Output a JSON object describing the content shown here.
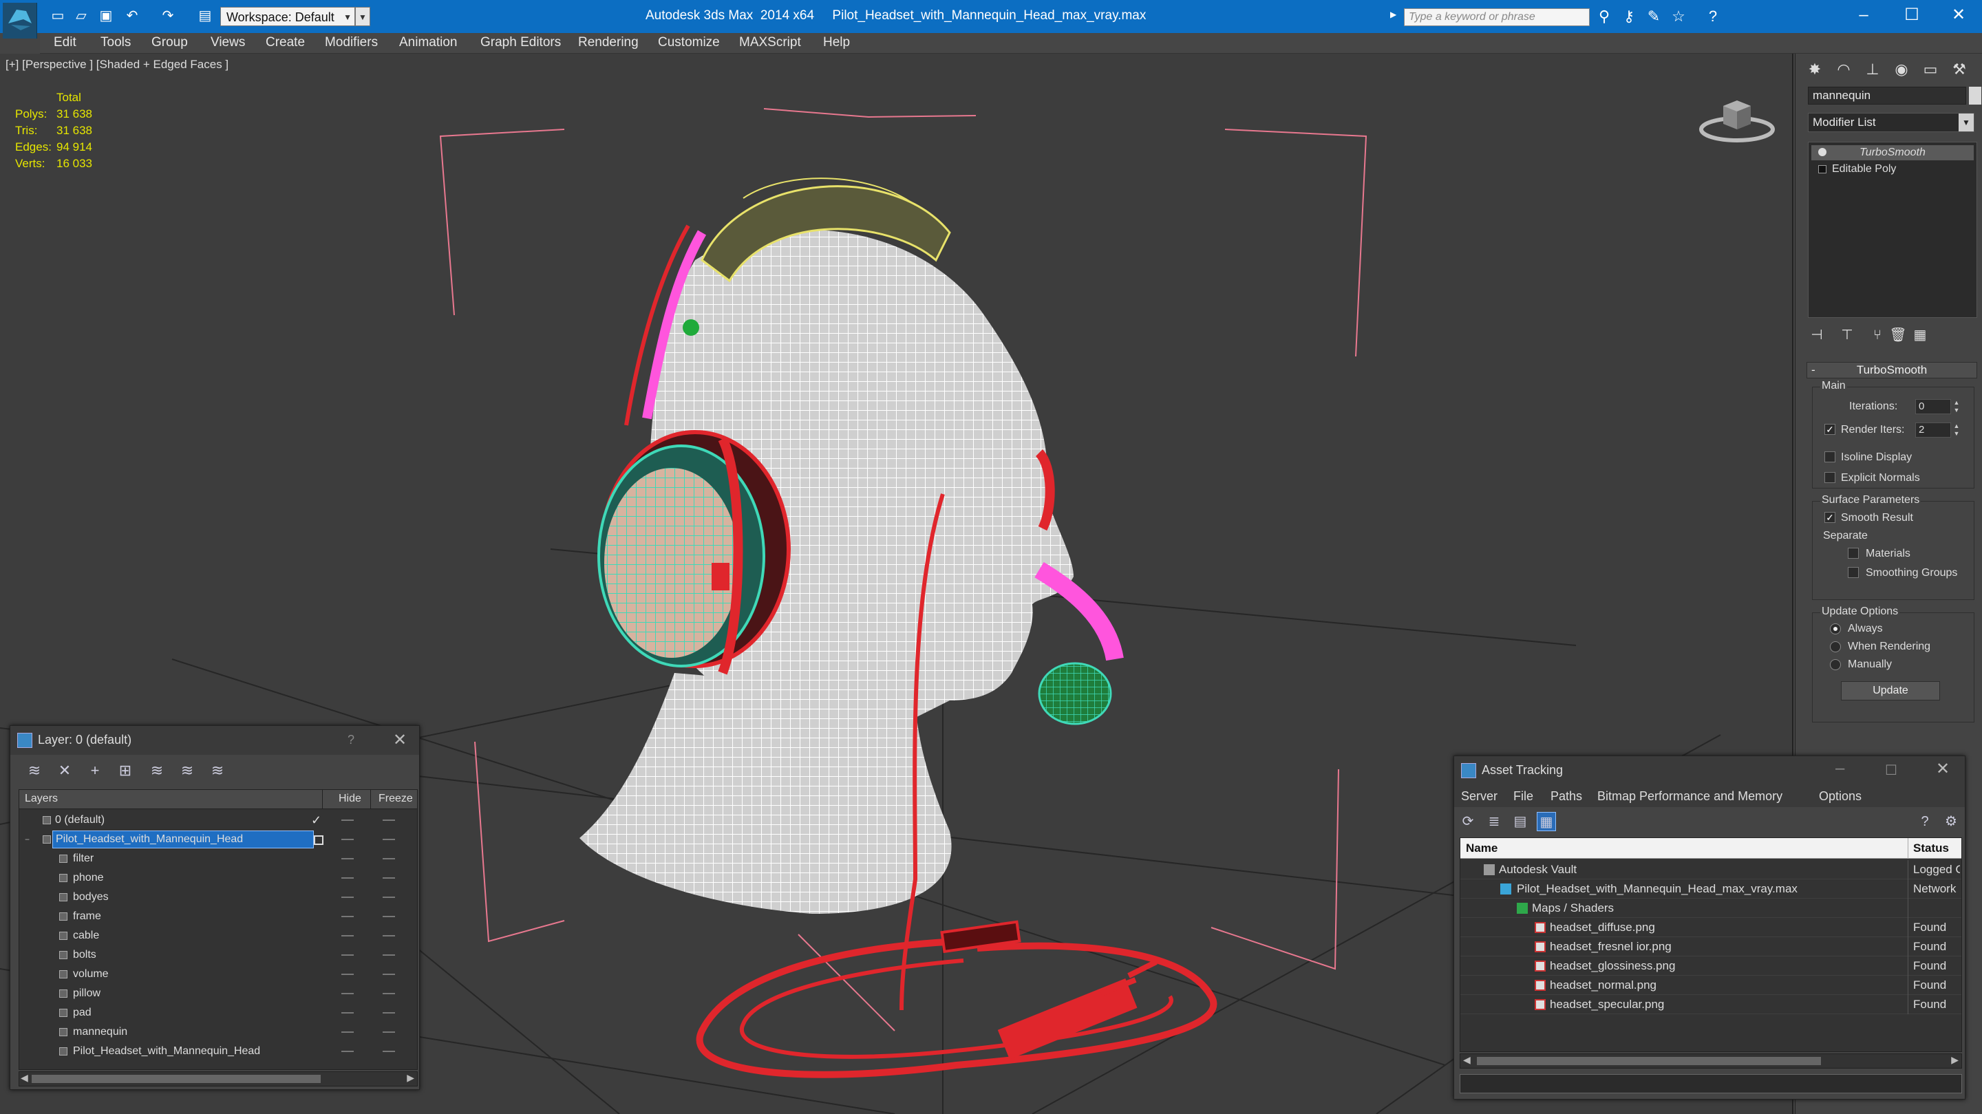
{
  "titlebar": {
    "workspace": "Workspace: Default",
    "app_title": "Autodesk 3ds Max  2014 x64     Pilot_Headset_with_Mannequin_Head_max_vray.max",
    "search_placeholder": "Type a keyword or phrase"
  },
  "menu": [
    "Edit",
    "Tools",
    "Group",
    "Views",
    "Create",
    "Modifiers",
    "Animation",
    "Graph Editors",
    "Rendering",
    "Customize",
    "MAXScript",
    "Help"
  ],
  "viewport": {
    "label": "[+] [Perspective ] [Shaded + Edged Faces ]",
    "stats": {
      "total_label": "Total",
      "rows": [
        {
          "label": "Polys:",
          "value": "31 638"
        },
        {
          "label": "Tris:",
          "value": "31 638"
        },
        {
          "label": "Edges:",
          "value": "94 914"
        },
        {
          "label": "Verts:",
          "value": "16 033"
        }
      ]
    }
  },
  "command_panel": {
    "object_name": "mannequin",
    "modifier_list": "Modifier List",
    "stack": [
      "TurboSmooth",
      "Editable Poly"
    ],
    "rollout": {
      "title": "TurboSmooth",
      "main_label": "Main",
      "iterations_label": "Iterations:",
      "iterations_value": "0",
      "render_iters_label": "Render Iters:",
      "render_iters_value": "2",
      "isoline_label": "Isoline Display",
      "explicit_normals_label": "Explicit Normals",
      "surface_params_label": "Surface Parameters",
      "smooth_result_label": "Smooth Result",
      "separate_label": "Separate",
      "materials_label": "Materials",
      "smoothing_groups_label": "Smoothing Groups",
      "update_options_label": "Update Options",
      "always_label": "Always",
      "when_rendering_label": "When Rendering",
      "manually_label": "Manually",
      "update_button": "Update"
    }
  },
  "layers_window": {
    "title": "Layer: 0 (default)",
    "col_layers": "Layers",
    "col_hide": "Hide",
    "col_freeze": "Freeze",
    "rows": [
      {
        "name": "0 (default)",
        "level": 0
      },
      {
        "name": "Pilot_Headset_with_Mannequin_Head",
        "level": 0
      },
      {
        "name": "filter",
        "level": 1
      },
      {
        "name": "phone",
        "level": 1
      },
      {
        "name": "bodyes",
        "level": 1
      },
      {
        "name": "frame",
        "level": 1
      },
      {
        "name": "cable",
        "level": 1
      },
      {
        "name": "bolts",
        "level": 1
      },
      {
        "name": "volume",
        "level": 1
      },
      {
        "name": "pillow",
        "level": 1
      },
      {
        "name": "pad",
        "level": 1
      },
      {
        "name": "mannequin",
        "level": 1
      },
      {
        "name": "Pilot_Headset_with_Mannequin_Head",
        "level": 1
      }
    ]
  },
  "asset_tracking": {
    "title": "Asset Tracking",
    "menu": [
      "Server",
      "File",
      "Paths",
      "Bitmap Performance and Memory",
      "Options"
    ],
    "col_name": "Name",
    "col_status": "Status",
    "rows": [
      {
        "name": "Autodesk Vault",
        "status": "Logged Out",
        "level": 0
      },
      {
        "name": "Pilot_Headset_with_Mannequin_Head_max_vray.max",
        "status": "Network Path",
        "level": 1
      },
      {
        "name": "Maps / Shaders",
        "status": "",
        "level": 2
      },
      {
        "name": "headset_diffuse.png",
        "status": "Found",
        "level": 3
      },
      {
        "name": "headset_fresnel ior.png",
        "status": "Found",
        "level": 3
      },
      {
        "name": "headset_glossiness.png",
        "status": "Found",
        "level": 3
      },
      {
        "name": "headset_normal.png",
        "status": "Found",
        "level": 3
      },
      {
        "name": "headset_specular.png",
        "status": "Found",
        "level": 3
      }
    ]
  },
  "colors": {
    "titlebar": "#0c6ec2",
    "selection": "#1f6ec2",
    "wire_head": "#ffffff",
    "wire_ear": "#3fd9b8",
    "wire_red": "#e0262c",
    "wire_pink": "#ff55dd",
    "wire_yellow": "#e8e26a"
  }
}
